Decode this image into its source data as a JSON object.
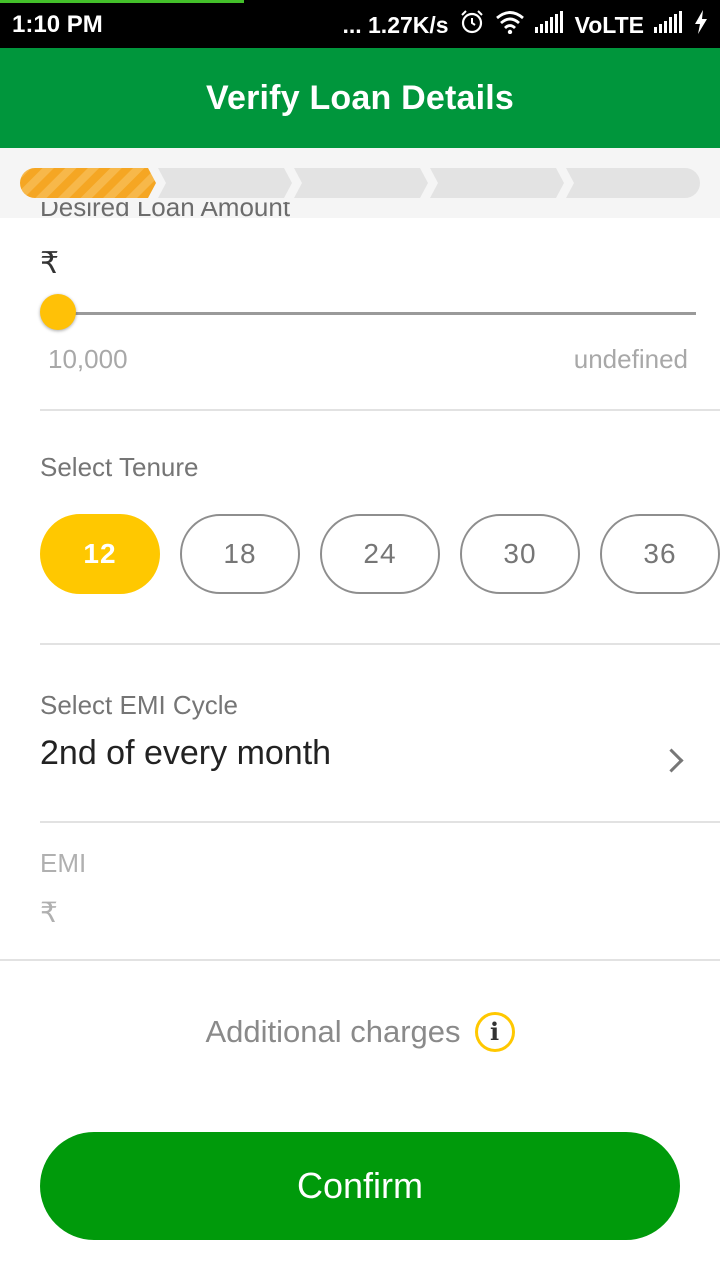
{
  "status_bar": {
    "time": "1:10 PM",
    "net_speed": "... 1.27K/s",
    "network": "VoLTE",
    "icons": [
      "alarm-icon",
      "wifi-icon",
      "signal-icon",
      "signal-icon",
      "charging-icon"
    ]
  },
  "header": {
    "title": "Verify Loan Details"
  },
  "stepper": {
    "total_steps": 5,
    "current_step": 1,
    "active_color": "#f5a623",
    "inactive_color": "#e3e3e3"
  },
  "loan_amount": {
    "label": "Desired Loan Amount",
    "currency": "₹",
    "slider_fraction": 0.0,
    "min_label": "10,000",
    "max_label": "undefined"
  },
  "tenure": {
    "label": "Select Tenure",
    "options": [
      "12",
      "18",
      "24",
      "30",
      "36"
    ],
    "selected": "12"
  },
  "emi_cycle": {
    "label": "Select EMI Cycle",
    "value": "2nd of every month"
  },
  "emi": {
    "label": "EMI",
    "currency": "₹"
  },
  "charges": {
    "label": "Additional charges",
    "icon": "info-icon",
    "info_glyph": "i"
  },
  "confirm": {
    "label": "Confirm"
  },
  "colors": {
    "primary": "#00963c",
    "button": "#009a0b",
    "accent": "#ffc800"
  }
}
